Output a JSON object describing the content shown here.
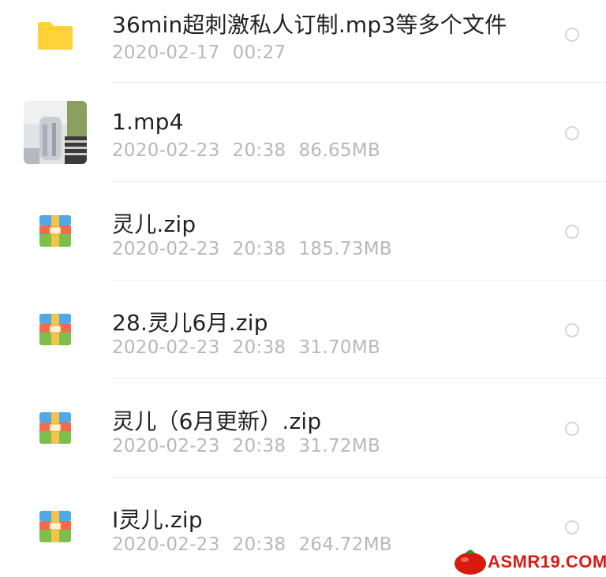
{
  "files": [
    {
      "name": "36min超刺激私人订制.mp3等多个文件",
      "date": "2020-02-17",
      "time": "00:27",
      "size": "",
      "icon": "folder-icon"
    },
    {
      "name": "1.mp4",
      "date": "2020-02-23",
      "time": "20:38",
      "size": "86.65MB",
      "icon": "video-thumbnail"
    },
    {
      "name": "灵儿.zip",
      "date": "2020-02-23",
      "time": "20:38",
      "size": "185.73MB",
      "icon": "zip-icon"
    },
    {
      "name": "28.灵儿6月.zip",
      "date": "2020-02-23",
      "time": "20:38",
      "size": "31.70MB",
      "icon": "zip-icon"
    },
    {
      "name": "灵儿（6月更新）.zip",
      "date": "2020-02-23",
      "time": "20:38",
      "size": "31.72MB",
      "icon": "zip-icon"
    },
    {
      "name": "I灵儿.zip",
      "date": "2020-02-23",
      "time": "20:38",
      "size": "264.72MB",
      "icon": "zip-icon"
    }
  ],
  "watermark": {
    "text": "ASMR19.COM",
    "color": "#d81b10"
  },
  "colors": {
    "folder": "#fdd23a",
    "title": "#222222",
    "meta": "#b8b8b8"
  }
}
